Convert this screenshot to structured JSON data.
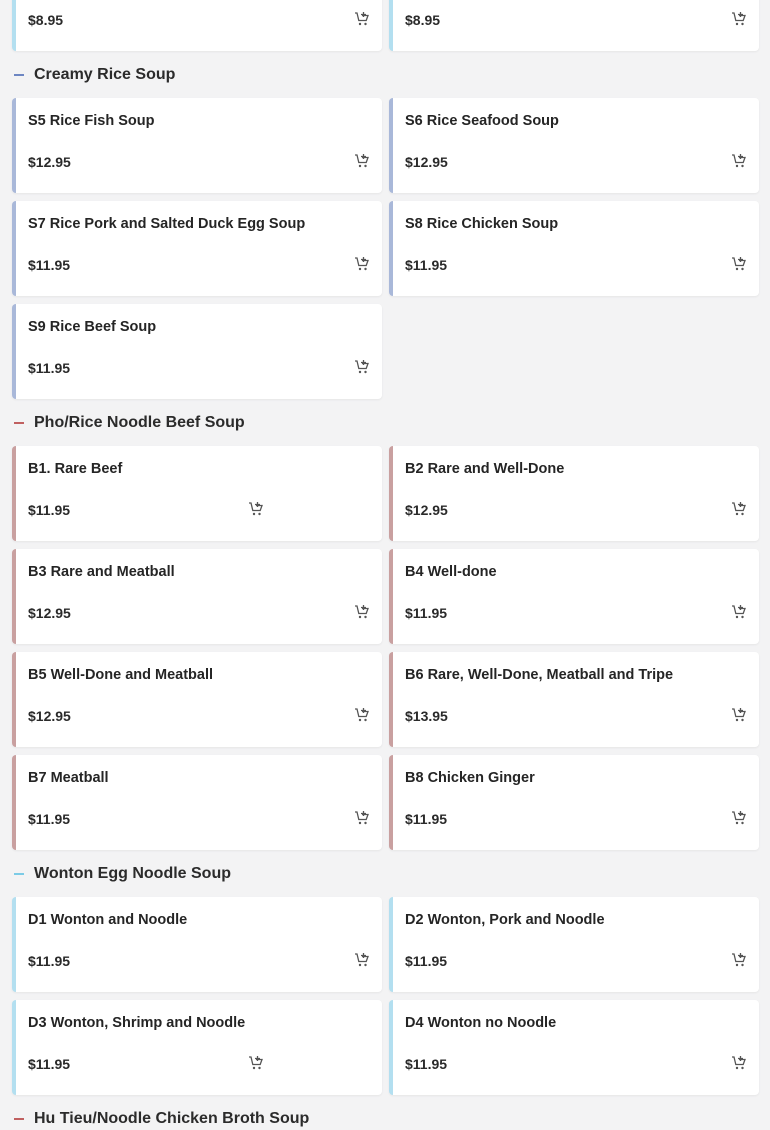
{
  "colors": {
    "soup_accent": "#a9b8d9",
    "beef_accent": "#c9a0a0",
    "wonton_accent": "#b3dff0",
    "top_accent": "#b3dff0",
    "beef_dash": "#c06060",
    "soup_dash": "#6d86c2",
    "wonton_dash": "#7ccbe6"
  },
  "top_row": [
    {
      "price": "$8.95"
    },
    {
      "price": "$8.95"
    }
  ],
  "sections": [
    {
      "title": "Creamy Rice Soup",
      "items": [
        {
          "name": "S5 Rice Fish Soup",
          "price": "$12.95"
        },
        {
          "name": "S6 Rice Seafood Soup",
          "price": "$12.95"
        },
        {
          "name": "S7 Rice Pork and Salted Duck Egg Soup",
          "price": "$11.95"
        },
        {
          "name": "S8 Rice Chicken Soup",
          "price": "$11.95"
        },
        {
          "name": "S9 Rice Beef Soup",
          "price": "$11.95"
        }
      ]
    },
    {
      "title": "Pho/Rice Noodle Beef Soup",
      "items": [
        {
          "name": "B1. Rare Beef",
          "price": "$11.95"
        },
        {
          "name": "B2 Rare and Well-Done",
          "price": "$12.95"
        },
        {
          "name": "B3 Rare and Meatball",
          "price": "$12.95"
        },
        {
          "name": "B4 Well-done",
          "price": "$11.95"
        },
        {
          "name": "B5 Well-Done and Meatball",
          "price": "$12.95"
        },
        {
          "name": "B6 Rare, Well-Done, Meatball and Tripe",
          "price": "$13.95"
        },
        {
          "name": "B7 Meatball",
          "price": "$11.95"
        },
        {
          "name": "B8 Chicken Ginger",
          "price": "$11.95"
        }
      ]
    },
    {
      "title": "Wonton Egg Noodle Soup",
      "items": [
        {
          "name": "D1 Wonton and Noodle",
          "price": "$11.95"
        },
        {
          "name": "D2 Wonton, Pork and Noodle",
          "price": "$11.95"
        },
        {
          "name": "D3 Wonton, Shrimp and Noodle",
          "price": "$11.95"
        },
        {
          "name": "D4 Wonton no Noodle",
          "price": "$11.95"
        }
      ]
    },
    {
      "title": "Hu Tieu/Noodle Chicken Broth Soup",
      "items": []
    }
  ],
  "icons": {
    "add_to_cart": "add-to-cart-icon"
  }
}
